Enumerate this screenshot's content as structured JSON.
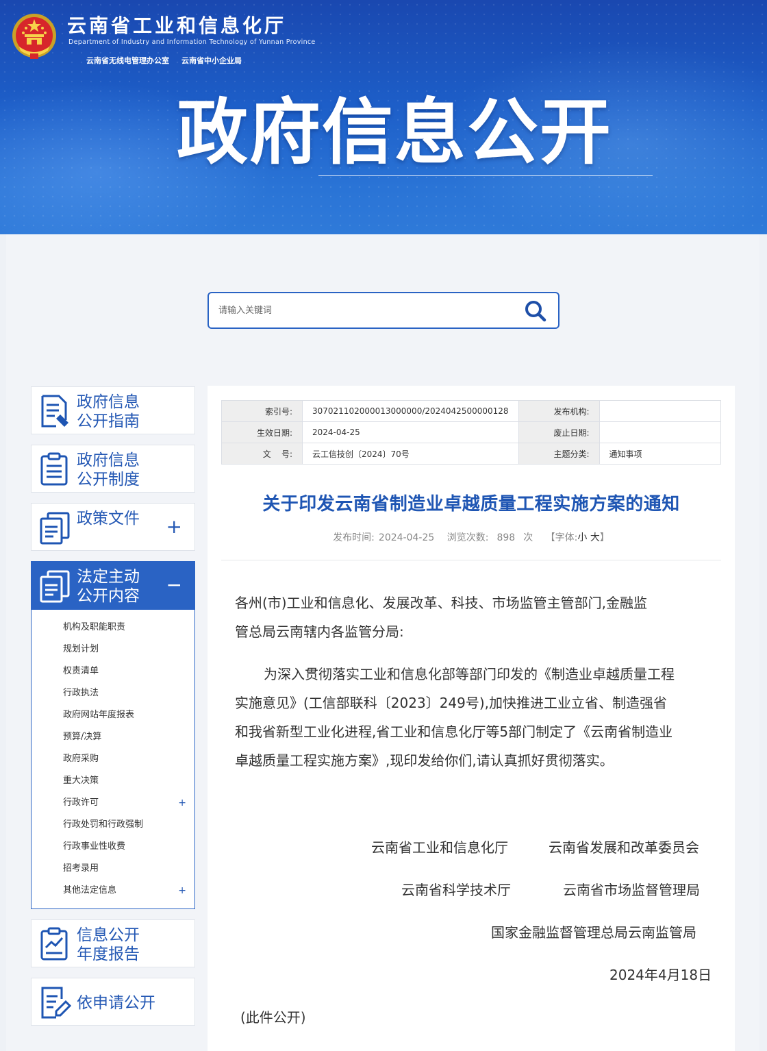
{
  "header": {
    "site_title": "云南省工业和信息化厅",
    "site_title_en": "Department of Industry and Information Technology of Yunnan Province",
    "sub_links": [
      "云南省无线电管理办公室",
      "云南省中小企业局"
    ],
    "banner_title": "政府信息公开"
  },
  "search": {
    "placeholder": "请输入关键词"
  },
  "sidebar": {
    "cards": [
      {
        "line1": "政府信息",
        "line2": "公开指南",
        "icon": "guide-doc-icon"
      },
      {
        "line1": "政府信息",
        "line2": "公开制度",
        "icon": "list-doc-icon"
      },
      {
        "line1": "政策文件",
        "toggle": "+",
        "icon": "policy-files-icon"
      },
      {
        "line1": "法定主动",
        "line2": "公开内容",
        "toggle": "−",
        "icon": "statutory-files-icon"
      },
      {
        "line1": "信息公开",
        "line2": "年度报告",
        "icon": "chart-report-icon"
      },
      {
        "line1": "依申请公开",
        "icon": "apply-edit-icon"
      }
    ],
    "sub_items": [
      {
        "label": "机构及职能职责"
      },
      {
        "label": "规划计划"
      },
      {
        "label": "权责清单"
      },
      {
        "label": "行政执法"
      },
      {
        "label": "政府网站年度报表"
      },
      {
        "label": "预算/决算"
      },
      {
        "label": "政府采购"
      },
      {
        "label": "重大决策"
      },
      {
        "label": "行政许可",
        "plus": "+"
      },
      {
        "label": "行政处罚和行政强制"
      },
      {
        "label": "行政事业性收费"
      },
      {
        "label": "招考录用"
      },
      {
        "label": "其他法定信息",
        "plus": "+"
      }
    ]
  },
  "meta": {
    "index_label": "索引号:",
    "index_value": "307021102000013000000/2024042500000128",
    "publisher_label": "发布机构:",
    "publisher_value": "",
    "effective_label": "生效日期:",
    "effective_value": "2024-04-25",
    "expire_label": "废止日期:",
    "expire_value": "",
    "docno_label": "文    号:",
    "docno_value": "云工信技创〔2024〕70号",
    "topic_label": "主题分类:",
    "topic_value": "通知事项"
  },
  "article": {
    "title": "关于印发云南省制造业卓越质量工程实施方案的通知",
    "publish_label": "发布时间:",
    "publish_date": "2024-04-25",
    "views_label": "浏览次数:",
    "views_count": "898",
    "views_unit": "次",
    "font_label": "【字体:",
    "font_small": "小",
    "font_large": "大",
    "font_close": "】",
    "para1_line1": "各州(市)工业和信息化、发展改革、科技、市场监管主管部门,金融监",
    "para1_line2": "管总局云南辖内各监管分局:",
    "para2_line1": "为深入贯彻落实工业和信息化部等部门印发的《制造业卓越质量工程",
    "para2_line2": "实施意见》(工信部联科〔2023〕249号),加快推进工业立省、制造强省",
    "para2_line3": "和我省新型工业化进程,省工业和信息化厅等5部门制定了《云南省制造业",
    "para2_line4": "卓越质量工程实施方案》,现印发给你们,请认真抓好贯彻落实。",
    "sig1": "云南省工业和信息化厅",
    "sig2": "云南省发展和改革委员会",
    "sig3": "云南省科学技术厅",
    "sig4": "云南省市场监督管理局",
    "sig5": "国家金融监督管理总局云南监管局",
    "date": "2024年4月18日",
    "public_note": "(此件公开)"
  }
}
